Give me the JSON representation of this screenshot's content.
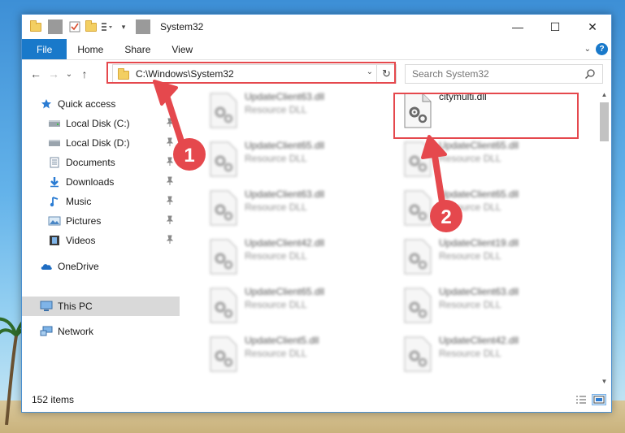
{
  "window": {
    "title": "System32",
    "controls": {
      "minimize": "—",
      "maximize": "☐",
      "close": "✕"
    }
  },
  "ribbon": {
    "tabs": [
      "File",
      "Home",
      "Share",
      "View"
    ],
    "expand_icon": "chevron-down-icon",
    "help_label": "?"
  },
  "navigation": {
    "back": "←",
    "forward": "→",
    "recent": "⌄",
    "up": "↑",
    "address": "C:\\Windows\\System32",
    "search_placeholder": "Search System32"
  },
  "sidebar": {
    "items": [
      {
        "label": "Quick access",
        "icon": "star-icon",
        "pinned": false
      },
      {
        "label": "Local Disk (C:)",
        "icon": "drive-icon",
        "pinned": true
      },
      {
        "label": "Local Disk (D:)",
        "icon": "drive-icon",
        "pinned": true
      },
      {
        "label": "Documents",
        "icon": "documents-icon",
        "pinned": true
      },
      {
        "label": "Downloads",
        "icon": "download-icon",
        "pinned": true
      },
      {
        "label": "Music",
        "icon": "music-icon",
        "pinned": true
      },
      {
        "label": "Pictures",
        "icon": "pictures-icon",
        "pinned": true
      },
      {
        "label": "Videos",
        "icon": "videos-icon",
        "pinned": true
      },
      {
        "label": "OneDrive",
        "icon": "cloud-icon",
        "pinned": false
      },
      {
        "label": "This PC",
        "icon": "monitor-icon",
        "pinned": false,
        "selected": true
      },
      {
        "label": "Network",
        "icon": "network-icon",
        "pinned": false
      }
    ]
  },
  "files": [
    {
      "name": "UpdateClient63.dll",
      "type": "Resource DLL",
      "blurred": true
    },
    {
      "name": "citymulti.dll",
      "type": "",
      "blurred": false,
      "highlighted": true
    },
    {
      "name": "UpdateClient65.dll",
      "type": "Resource DLL",
      "blurred": true
    },
    {
      "name": "UpdateClient65.dll",
      "type": "Resource DLL",
      "blurred": true
    },
    {
      "name": "UpdateClient63.dll",
      "type": "Resource DLL",
      "blurred": true
    },
    {
      "name": "UpdateClient65.dll",
      "type": "Resource DLL",
      "blurred": true
    },
    {
      "name": "UpdateClient42.dll",
      "type": "Resource DLL",
      "blurred": true
    },
    {
      "name": "UpdateClient19.dll",
      "type": "Resource DLL",
      "blurred": true
    },
    {
      "name": "UpdateClient65.dll",
      "type": "Resource DLL",
      "blurred": true
    },
    {
      "name": "UpdateClient63.dll",
      "type": "Resource DLL",
      "blurred": true
    },
    {
      "name": "UpdateClient5.dll",
      "type": "Resource DLL",
      "blurred": true
    },
    {
      "name": "UpdateClient42.dll",
      "type": "Resource DLL",
      "blurred": true
    }
  ],
  "status": {
    "item_count": "152 items"
  },
  "annotations": {
    "step1": "1",
    "step2": "2",
    "color": "#e5484d"
  }
}
